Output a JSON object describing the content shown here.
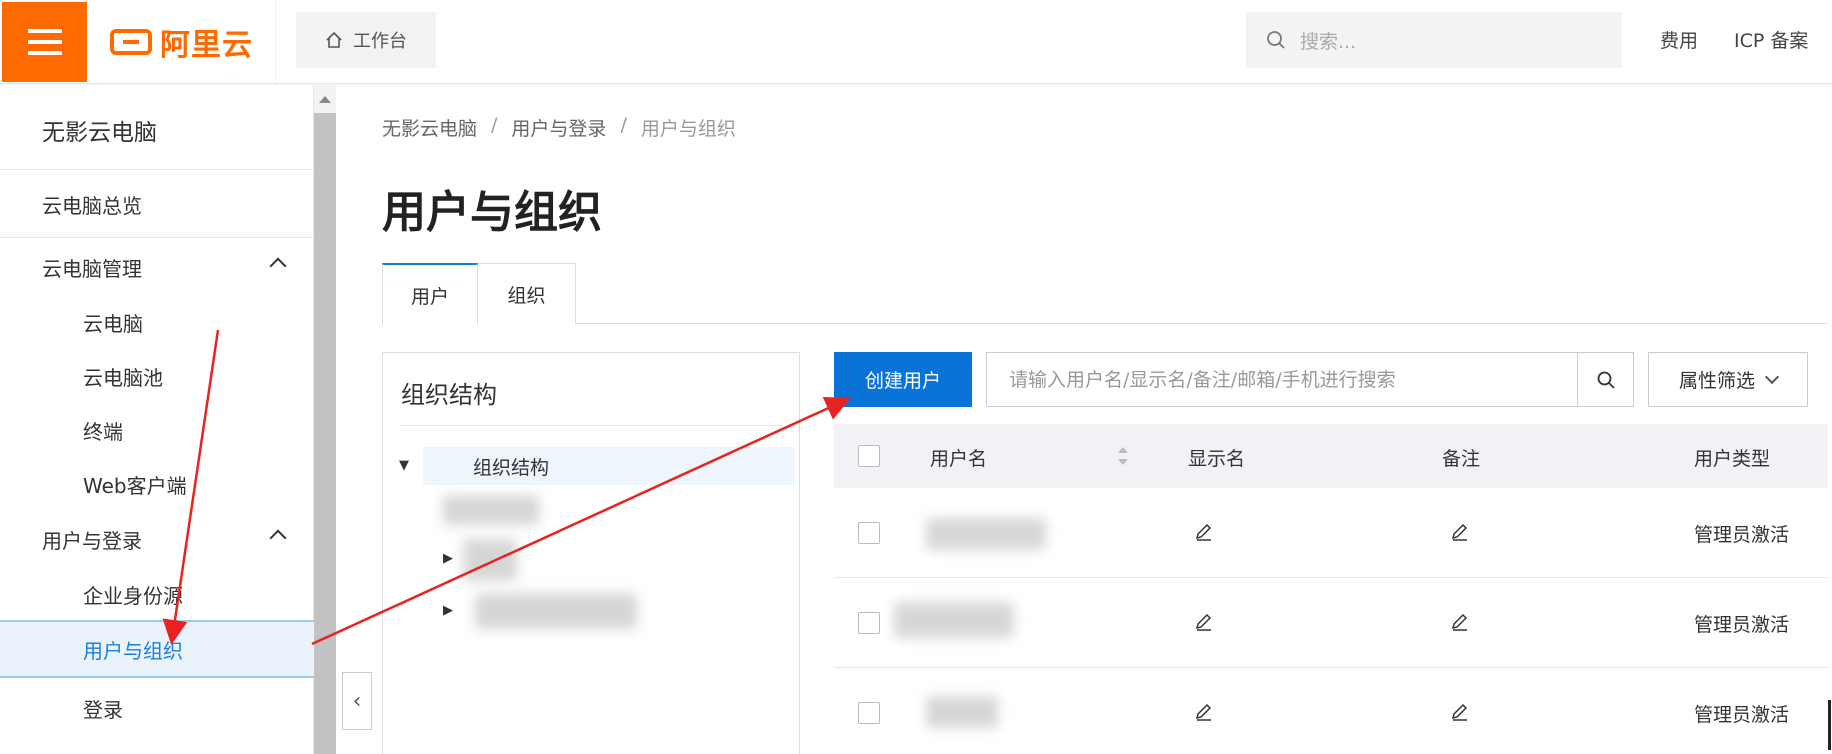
{
  "topbar": {
    "brand": "阿里云",
    "workbench_label": "工作台",
    "search_placeholder": "搜索...",
    "links": [
      "费用",
      "ICP 备案"
    ]
  },
  "sidebar": {
    "title": "无影云电脑",
    "items": [
      {
        "label": "云电脑总览",
        "level": 1
      },
      {
        "label": "云电脑管理",
        "level": 1,
        "expanded": true
      },
      {
        "label": "云电脑",
        "level": 2
      },
      {
        "label": "云电脑池",
        "level": 2
      },
      {
        "label": "终端",
        "level": 2
      },
      {
        "label": "Web客户端",
        "level": 2
      },
      {
        "label": "用户与登录",
        "level": 1,
        "expanded": true
      },
      {
        "label": "企业身份源",
        "level": 2
      },
      {
        "label": "用户与组织",
        "level": 2,
        "active": true
      },
      {
        "label": "登录",
        "level": 2
      }
    ]
  },
  "breadcrumb": [
    "无影云电脑",
    "用户与登录",
    "用户与组织"
  ],
  "page_title": "用户与组织",
  "tabs": [
    {
      "label": "用户",
      "active": true
    },
    {
      "label": "组织",
      "active": false
    }
  ],
  "org_panel": {
    "title": "组织结构",
    "tree_root": "组织结构"
  },
  "toolbar": {
    "create_label": "创建用户",
    "search_placeholder": "请输入用户名/显示名/备注/邮箱/手机进行搜索",
    "filter_label": "属性筛选"
  },
  "table": {
    "columns": [
      "用户名",
      "显示名",
      "备注",
      "用户类型"
    ],
    "rows": [
      {
        "user_type": "管理员激活"
      },
      {
        "user_type": "管理员激活"
      },
      {
        "user_type": "管理员激活"
      }
    ]
  },
  "colors": {
    "brand": "#ff6a00",
    "primary": "#0a73d8",
    "annotation_arrow": "#e8231f"
  }
}
